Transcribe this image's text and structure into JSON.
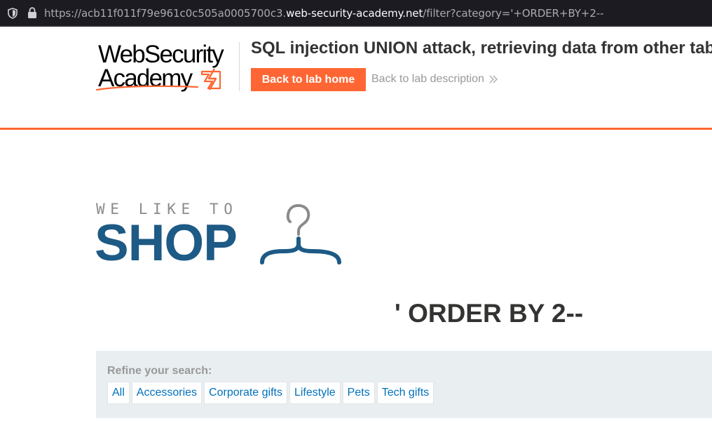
{
  "browser": {
    "url_prefix": "https://acb11f011f79e961c0c505a0005700c3.",
    "url_domain": "web-security-academy.net",
    "url_path": "/filter?category='+ORDER+BY+2--"
  },
  "academy": {
    "logo_line1": "WebSecurity",
    "logo_line2": "Academy",
    "lab_title": "SQL injection UNION attack, retrieving data from other tables",
    "back_to_lab_home": "Back to lab home",
    "back_to_lab_description": "Back to lab description",
    "accent_color": "#ff6633"
  },
  "shop": {
    "tagline": "WE LIKE TO",
    "name": "SHOP",
    "brand_color": "#1d5a85"
  },
  "search_heading": "' ORDER BY 2--",
  "filters": {
    "label": "Refine your search:",
    "categories": [
      "All",
      "Accessories",
      "Corporate gifts",
      "Lifestyle",
      "Pets",
      "Tech gifts"
    ]
  }
}
